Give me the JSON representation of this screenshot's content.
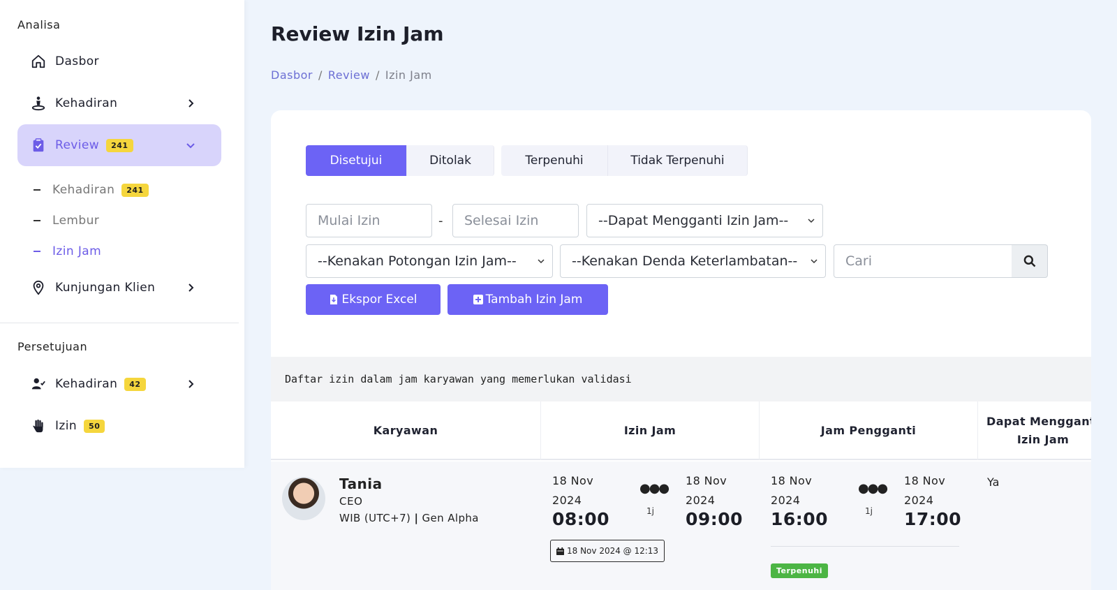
{
  "sidebar": {
    "analisa_title": "Analisa",
    "persetujuan_title": "Persetujuan",
    "items": [
      {
        "label": "Dasbor",
        "icon": "home-icon"
      },
      {
        "label": "Kehadiran",
        "icon": "person-location-icon"
      },
      {
        "label": "Review",
        "icon": "clipboard-check-icon",
        "badge": "241"
      },
      {
        "label": "Kunjungan Klien",
        "icon": "map-pin-icon"
      }
    ],
    "review_sub": [
      {
        "label": "Kehadiran",
        "badge": "241"
      },
      {
        "label": "Lembur"
      },
      {
        "label": "Izin Jam"
      }
    ],
    "persetujuan_items": [
      {
        "label": "Kehadiran",
        "icon": "user-check-icon",
        "badge": "42"
      },
      {
        "label": "Izin",
        "icon": "hand-icon",
        "badge": "50"
      }
    ]
  },
  "page": {
    "title": "Review Izin Jam",
    "breadcrumb": [
      "Dasbor",
      "Review",
      "Izin Jam"
    ]
  },
  "tabs": [
    "Disetujui",
    "Ditolak",
    "Terpenuhi",
    "Tidak Terpenuhi"
  ],
  "filters": {
    "start_placeholder": "Mulai Izin",
    "separator": "-",
    "end_placeholder": "Selesai Izin",
    "replace_select": "--Dapat Mengganti Izin Jam--",
    "cut_select": "--Kenakan Potongan Izin Jam--",
    "fine_select": "--Kenakan Denda Keterlambatan--",
    "search_placeholder": "Cari"
  },
  "actions": {
    "export": "Ekspor Excel",
    "add": "Tambah Izin Jam"
  },
  "info_text": "Daftar izin dalam jam karyawan yang memerlukan validasi",
  "table": {
    "headers": [
      "Karyawan",
      "Izin Jam",
      "Jam Pengganti",
      "Dapat Mengganti Izin Jam"
    ],
    "rows": [
      {
        "name": "Tania",
        "role": "CEO",
        "zone": "WIB (UTC+7)",
        "zone_sep": "|",
        "company": "Gen Alpha",
        "izin": {
          "start_date": "18 Nov 2024",
          "start_time": "08:00",
          "end_date": "18 Nov 2024",
          "end_time": "09:00",
          "duration": "1j",
          "created": "18 Nov 2024 @ 12:13"
        },
        "pengganti": {
          "start_date": "18 Nov 2024",
          "start_time": "16:00",
          "end_date": "18 Nov 2024",
          "end_time": "17:00",
          "duration": "1j",
          "status": "Terpenuhi"
        },
        "can_replace": "Ya"
      }
    ]
  },
  "colors": {
    "accent": "#6c63f5",
    "badge": "#f5d63d",
    "status_green": "#4cb544"
  }
}
